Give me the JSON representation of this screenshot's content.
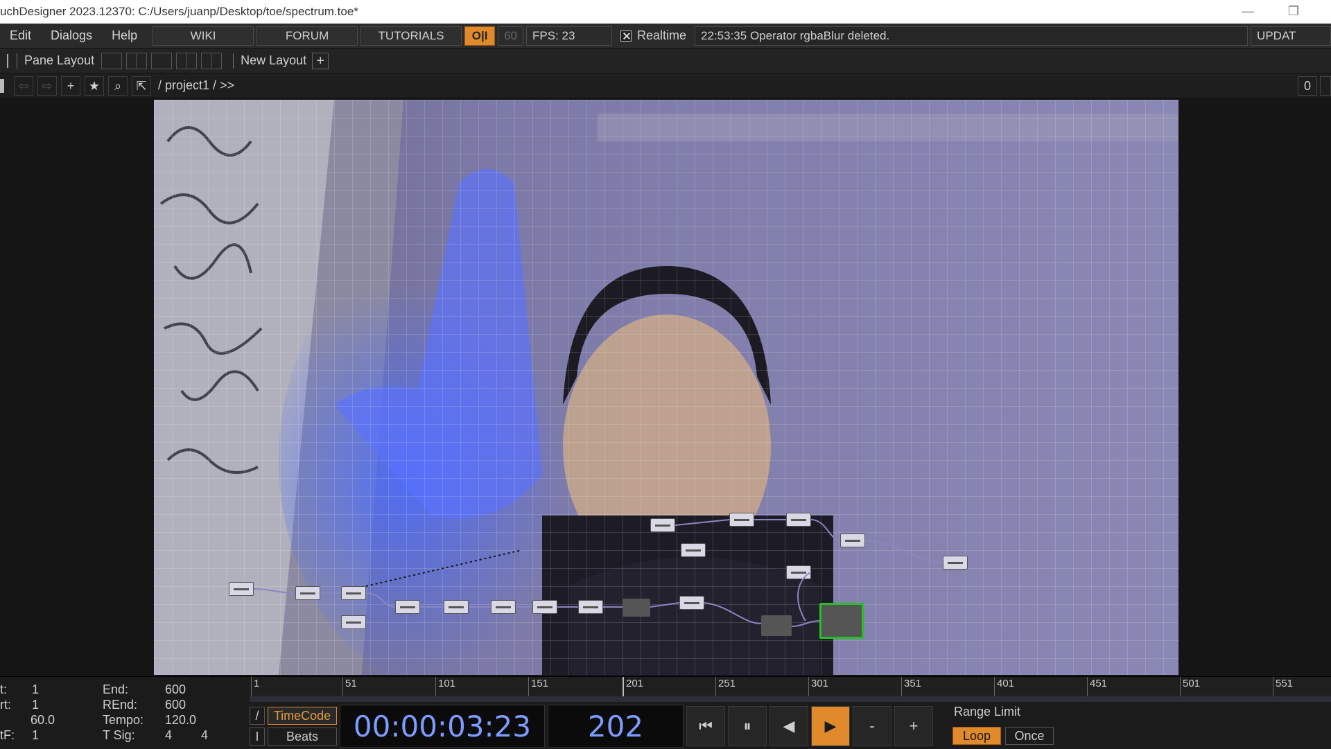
{
  "titlebar": {
    "title": "uchDesigner 2023.12370: C:/Users/juanp/Desktop/toe/spectrum.toe*"
  },
  "menubar": {
    "items": [
      "Edit",
      "Dialogs",
      "Help"
    ],
    "links": [
      "WIKI",
      "FORUM",
      "TUTORIALS"
    ],
    "oi_label": "O|I",
    "fps_target": "60",
    "fps_label": "FPS:  23",
    "realtime_label": "Realtime",
    "status_message": "22:53:35 Operator rgbaBlur deleted.",
    "update_label": "UPDAT"
  },
  "panebar": {
    "pane_layout_label": "Pane Layout",
    "new_layout_label": "New Layout",
    "plus_label": "+"
  },
  "pathbar": {
    "path": "/ project1 /  >>",
    "right_value": "0"
  },
  "timeline": {
    "info": {
      "start_label": "t:",
      "start_value": "1",
      "rstart_label": "rt:",
      "rstart_value": "1",
      "fps_value": "60.0",
      "tf_label": "tF:",
      "tf_value": "1",
      "end_label": "End:",
      "end_value": "600",
      "rend_label": "REnd:",
      "rend_value": "600",
      "tempo_label": "Tempo:",
      "tempo_value": "120.0",
      "tsig_label": "T Sig:",
      "tsig_a": "4",
      "tsig_b": "4"
    },
    "ruler_ticks": [
      "1",
      "51",
      "101",
      "151",
      "201",
      "251",
      "301",
      "351",
      "401",
      "451",
      "501",
      "551"
    ],
    "timecode_label": "TimeCode",
    "beats_label": "Beats",
    "timecode": "00:00:03:23",
    "frame": "202",
    "range_limit_label": "Range Limit",
    "loop_label": "Loop",
    "once_label": "Once",
    "minus_label": "-",
    "plus_label": "+"
  },
  "colors": {
    "accent": "#e08a2c",
    "selected_node": "#23c223",
    "timecode_text": "#7d9cff"
  }
}
